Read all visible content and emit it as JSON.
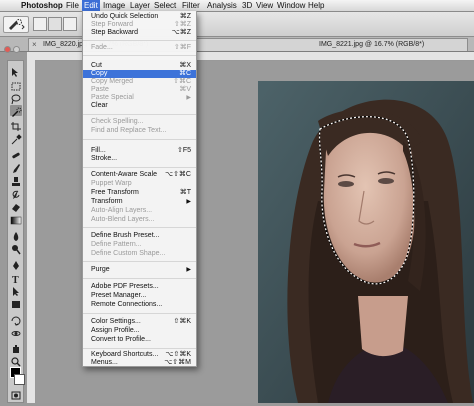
{
  "menubar": {
    "apple": "",
    "items": [
      "Photoshop",
      "File",
      "Edit",
      "Image",
      "Layer",
      "Select",
      "Filter",
      "Analysis",
      "3D",
      "View",
      "Window",
      "Help"
    ],
    "active": "Edit"
  },
  "document": {
    "tab_title_left": "IMG_8220.jpg @ 16.7% (RGB/8*)",
    "tab_title_right": "IMG_8221.jpg @ 16.7% (RGB/8*)"
  },
  "edit_menu": {
    "items": [
      {
        "label": "Undo Quick Selection",
        "shortcut": "⌘Z",
        "enabled": true
      },
      {
        "label": "Step Forward",
        "shortcut": "⇧⌘Z",
        "enabled": false
      },
      {
        "label": "Step Backward",
        "shortcut": "⌥⌘Z",
        "enabled": true
      },
      {
        "label": "Fade...",
        "shortcut": "⇧⌘F",
        "enabled": false
      },
      {
        "label": "Cut",
        "shortcut": "⌘X",
        "enabled": true
      },
      {
        "label": "Copy",
        "shortcut": "⌘C",
        "enabled": true,
        "highlighted": true
      },
      {
        "label": "Copy Merged",
        "shortcut": "⇧⌘C",
        "enabled": false
      },
      {
        "label": "Paste",
        "shortcut": "⌘V",
        "enabled": false
      },
      {
        "label": "Paste Special",
        "submenu": true,
        "enabled": false
      },
      {
        "label": "Clear",
        "enabled": true
      },
      {
        "label": "Check Spelling...",
        "enabled": false
      },
      {
        "label": "Find and Replace Text...",
        "enabled": false
      },
      {
        "label": "Fill...",
        "shortcut": "⇧F5",
        "enabled": true
      },
      {
        "label": "Stroke...",
        "enabled": true
      },
      {
        "label": "Content-Aware Scale",
        "shortcut": "⌥⇧⌘C",
        "enabled": true
      },
      {
        "label": "Puppet Warp",
        "enabled": false
      },
      {
        "label": "Free Transform",
        "shortcut": "⌘T",
        "enabled": true
      },
      {
        "label": "Transform",
        "submenu": true,
        "enabled": true
      },
      {
        "label": "Auto-Align Layers...",
        "enabled": false
      },
      {
        "label": "Auto-Blend Layers...",
        "enabled": false
      },
      {
        "label": "Define Brush Preset...",
        "enabled": true
      },
      {
        "label": "Define Pattern...",
        "enabled": false
      },
      {
        "label": "Define Custom Shape...",
        "enabled": false
      },
      {
        "label": "Purge",
        "submenu": true,
        "enabled": true
      },
      {
        "label": "Adobe PDF Presets...",
        "enabled": true
      },
      {
        "label": "Preset Manager...",
        "enabled": true
      },
      {
        "label": "Remote Connections...",
        "enabled": true
      },
      {
        "label": "Color Settings...",
        "shortcut": "⇧⌘K",
        "enabled": true
      },
      {
        "label": "Assign Profile...",
        "enabled": true
      },
      {
        "label": "Convert to Profile...",
        "enabled": true
      },
      {
        "label": "Keyboard Shortcuts...",
        "shortcut": "⌥⇧⌘K",
        "enabled": true
      },
      {
        "label": "Menus...",
        "shortcut": "⌥⇧⌘M",
        "enabled": true
      }
    ]
  },
  "colors": {
    "menu_highlight": "#3d73d9",
    "foreground_swatch": "#000000",
    "background_swatch": "#ffffff"
  }
}
